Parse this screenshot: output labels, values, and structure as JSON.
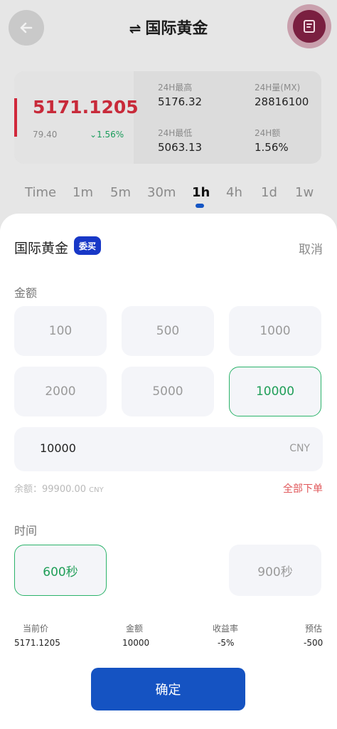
{
  "header": {
    "title": "国际黄金",
    "swap_icon": "⇌"
  },
  "quote": {
    "price": "5171.1205",
    "open": "79.40",
    "change": "1.56%",
    "stats": [
      {
        "label": "24H最高",
        "value": "5176.32"
      },
      {
        "label": "24H量(MX)",
        "value": "28816100"
      },
      {
        "label": "24H最低",
        "value": "5063.13"
      },
      {
        "label": "24H额",
        "value": "1.56%"
      }
    ]
  },
  "timeframes": [
    "Time",
    "1m",
    "5m",
    "30m",
    "1h",
    "4h",
    "1d",
    "1w"
  ],
  "active_timeframe": "1h",
  "sheet": {
    "title": "国际黄金",
    "badge": "委买",
    "cancel": "取消",
    "amount_label": "金额",
    "amount_options": [
      "100",
      "500",
      "1000",
      "2000",
      "5000",
      "10000"
    ],
    "selected_amount": "10000",
    "amount_value": "10000",
    "currency": "CNY",
    "balance_label": "余额：99900.00",
    "balance_unit": "CNY",
    "all_order": "全部下单",
    "time_label": "时间",
    "time_options": [
      "600秒",
      "900秒"
    ],
    "selected_time": "600秒",
    "summary": [
      {
        "label": "当前价",
        "value": "5171.1205"
      },
      {
        "label": "金额",
        "value": "10000"
      },
      {
        "label": "收益率",
        "value": "-5%"
      },
      {
        "label": "预估",
        "value": "-500"
      }
    ],
    "confirm": "确定"
  },
  "colors": {
    "accent": "#1553c2",
    "selected": "#2bb36a",
    "price": "#c82a3a",
    "badge": "#1838c7"
  }
}
